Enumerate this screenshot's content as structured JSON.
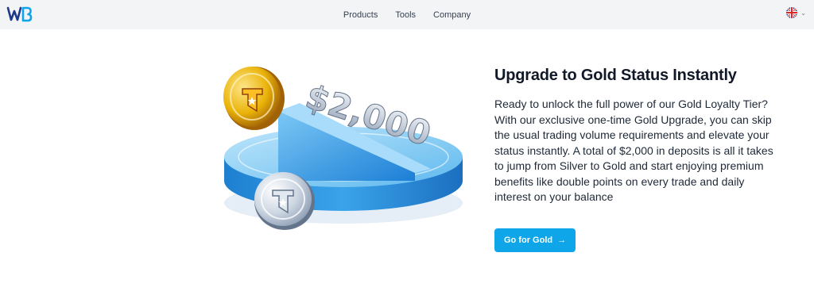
{
  "brand": {
    "logo_text": "WB",
    "accent": "#0ea5e9"
  },
  "nav": {
    "items": [
      "Products",
      "Tools",
      "Company"
    ]
  },
  "language": {
    "flag_icon": "uk-flag-icon",
    "caret_icon": "chevron-down-icon"
  },
  "hero": {
    "art_amount": "$2,000",
    "title": "Upgrade to Gold Status Instantly",
    "description": "Ready to unlock the full power of our Gold Loyalty Tier? With our exclusive one-time Gold Upgrade, you can skip the usual trading volume requirements and elevate your status instantly. A total of $2,000 in deposits is all it takes to jump from Silver to Gold and start enjoying premium benefits like double points on every trade and daily interest on your balance",
    "cta_label": "Go for Gold",
    "cta_icon": "arrow-right-icon"
  }
}
